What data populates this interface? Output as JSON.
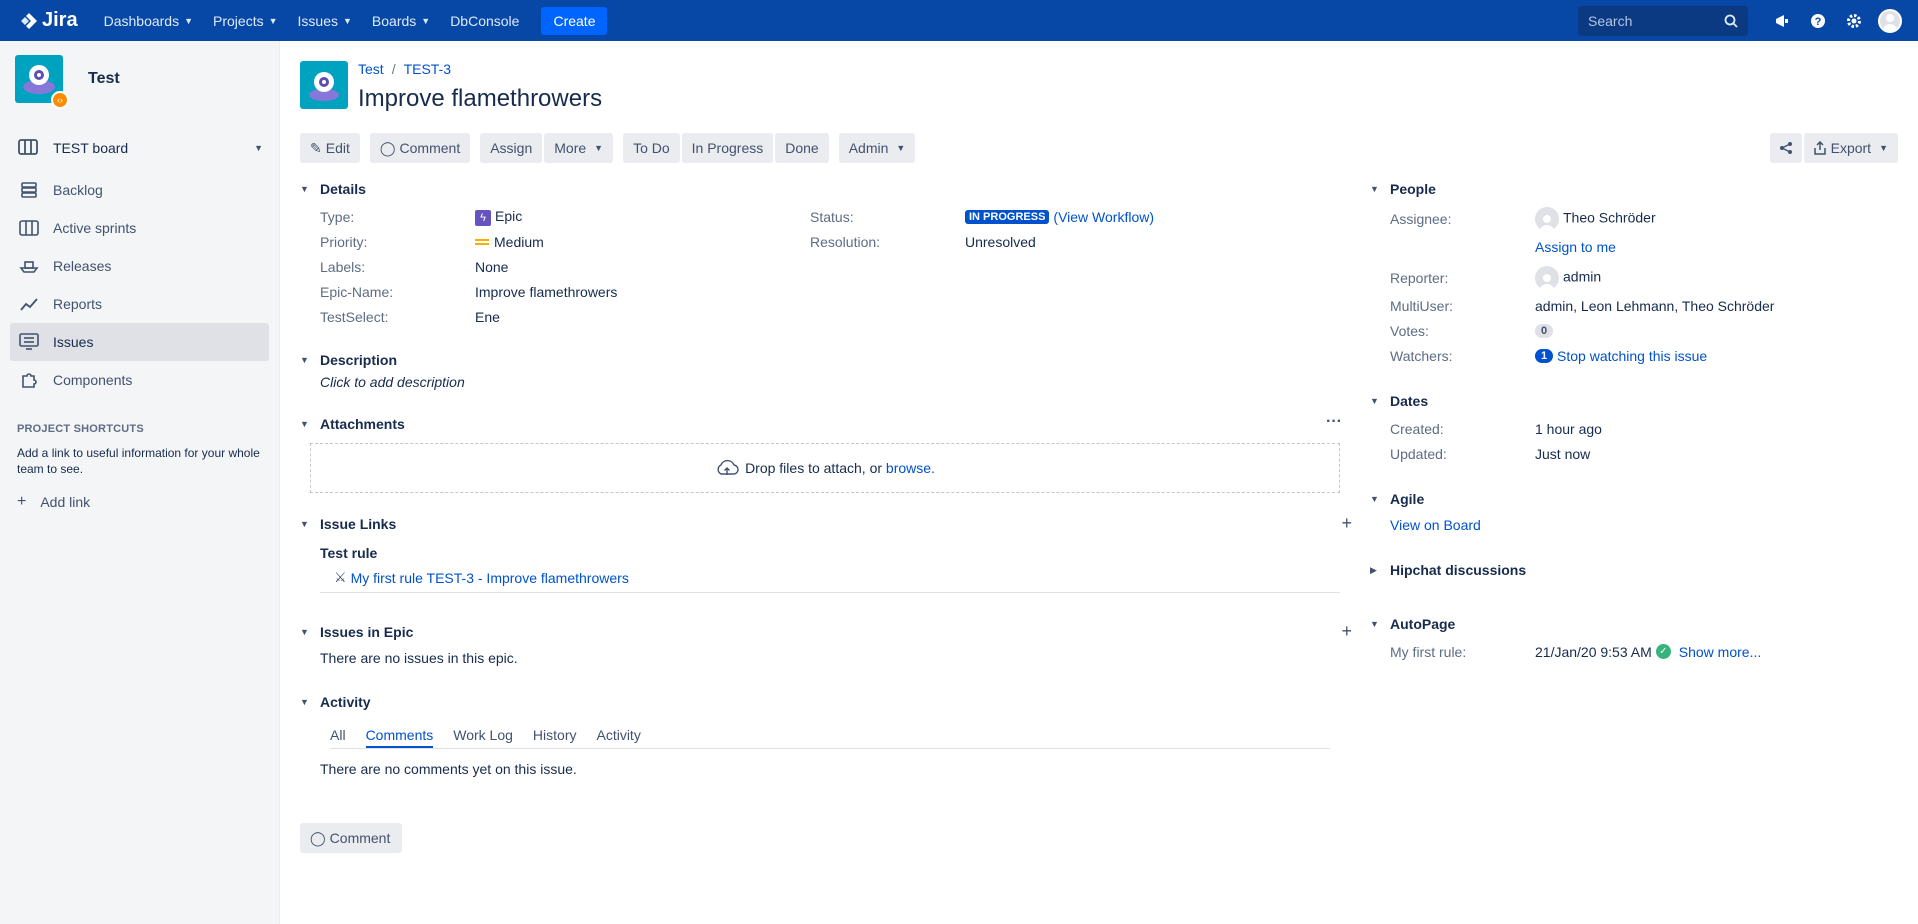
{
  "topnav": {
    "logo_text": "Jira",
    "items": [
      {
        "label": "Dashboards"
      },
      {
        "label": "Projects"
      },
      {
        "label": "Issues"
      },
      {
        "label": "Boards"
      }
    ],
    "dbconsole": "DbConsole",
    "create": "Create",
    "search_placeholder": "Search",
    "icons": [
      "megaphone-icon",
      "help-icon",
      "settings-icon",
      "user-avatar"
    ]
  },
  "sidebar": {
    "project_name": "Test",
    "board": "TEST board",
    "items": [
      {
        "label": "Backlog",
        "icon": "backlog-icon"
      },
      {
        "label": "Active sprints",
        "icon": "sprints-icon"
      },
      {
        "label": "Releases",
        "icon": "ship-icon"
      },
      {
        "label": "Reports",
        "icon": "chart-icon"
      },
      {
        "label": "Issues",
        "icon": "issues-icon",
        "active": true
      },
      {
        "label": "Components",
        "icon": "puzzle-icon"
      }
    ],
    "shortcuts_heading": "PROJECT SHORTCUTS",
    "shortcuts_text": "Add a link to useful information for your whole team to see.",
    "add_link": "Add link"
  },
  "issue": {
    "breadcrumb_project": "Test",
    "breadcrumb_key": "TEST-3",
    "title": "Improve flamethrowers"
  },
  "toolbar": {
    "edit": "Edit",
    "comment": "Comment",
    "assign": "Assign",
    "more": "More",
    "todo": "To Do",
    "in_progress": "In Progress",
    "done": "Done",
    "admin": "Admin",
    "export": "Export"
  },
  "details": {
    "heading": "Details",
    "type_label": "Type:",
    "type_value": "Epic",
    "priority_label": "Priority:",
    "priority_value": "Medium",
    "labels_label": "Labels:",
    "labels_value": "None",
    "epicname_label": "Epic-Name:",
    "epicname_value": "Improve flamethrowers",
    "testselect_label": "TestSelect:",
    "testselect_value": "Ene",
    "status_label": "Status:",
    "status_value": "IN PROGRESS",
    "view_workflow": "(View Workflow)",
    "resolution_label": "Resolution:",
    "resolution_value": "Unresolved"
  },
  "description": {
    "heading": "Description",
    "placeholder": "Click to add description"
  },
  "attachments": {
    "heading": "Attachments",
    "drop_text": "Drop files to attach, or",
    "browse": "browse."
  },
  "issue_links": {
    "heading": "Issue Links",
    "group": "Test rule",
    "link_text": "My first rule TEST-3 - Improve flamethrowers"
  },
  "issues_in_epic": {
    "heading": "Issues in Epic",
    "empty": "There are no issues in this epic."
  },
  "activity": {
    "heading": "Activity",
    "tabs": [
      "All",
      "Comments",
      "Work Log",
      "History",
      "Activity"
    ],
    "active_tab": "Comments",
    "empty": "There are no comments yet on this issue.",
    "comment_button": "Comment"
  },
  "people": {
    "heading": "People",
    "assignee_label": "Assignee:",
    "assignee": "Theo Schröder",
    "assign_to_me": "Assign to me",
    "reporter_label": "Reporter:",
    "reporter": "admin",
    "multiuser_label": "MultiUser:",
    "multiuser": "admin, Leon Lehmann, Theo Schröder",
    "votes_label": "Votes:",
    "votes": "0",
    "watchers_label": "Watchers:",
    "watchers": "1",
    "stop_watching": "Stop watching this issue"
  },
  "dates": {
    "heading": "Dates",
    "created_label": "Created:",
    "created": "1 hour ago",
    "updated_label": "Updated:",
    "updated": "Just now"
  },
  "agile": {
    "heading": "Agile",
    "view_on_board": "View on Board"
  },
  "hipchat": {
    "heading": "Hipchat discussions"
  },
  "autopage": {
    "heading": "AutoPage",
    "rule_label": "My first rule:",
    "rule_date": "21/Jan/20 9:53 AM",
    "show_more": "Show more..."
  }
}
